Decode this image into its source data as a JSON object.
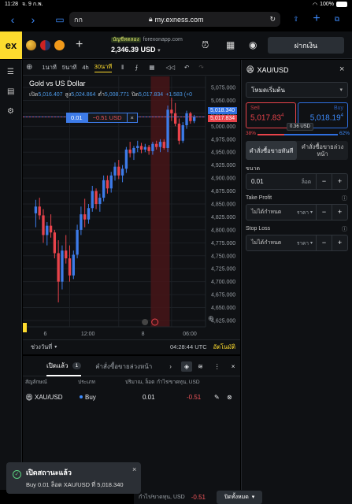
{
  "status": {
    "time": "11:28",
    "date": "จ. 9 ก.พ.",
    "battery": "100%"
  },
  "browser": {
    "tab_label": "กก",
    "url": "my.exness.com"
  },
  "header": {
    "account_tag": "บัญชีทดลอง",
    "server": "forexonapp.com",
    "balance": "2,346.39 USD",
    "deposit_label": "ฝากเงิน"
  },
  "toolbar": {
    "tf1": "1นาที",
    "tf5": "5นาที",
    "tf4h": "4h",
    "tf30": "30นาที"
  },
  "chart": {
    "title": "Gold vs US Dollar",
    "ohlc_open_label": "เปิด",
    "open": "5,016.407",
    "ohlc_high_label": "สูง",
    "high": "5,024.864",
    "ohlc_low_label": "ต่ำ",
    "low": "5,008.771",
    "ohlc_close_label": "ปิด",
    "close": "5,017.834",
    "change": "+1.583 (+0",
    "position_volume": "0.01",
    "position_pl": "−0.51 USD",
    "price_ask": "5,018.340",
    "price_bid": "5,017.834",
    "y_ticks": [
      "5,075.000",
      "5,050.000",
      "5,025.000",
      "5,000.000",
      "4,975.000",
      "4,950.000",
      "4,925.000",
      "4,900.000",
      "4,875.000",
      "4,850.000",
      "4,825.000",
      "4,800.000",
      "4,775.000",
      "4,750.000",
      "4,725.000",
      "4,700.000",
      "4,675.000",
      "4,650.000",
      "4,625.000"
    ],
    "x_ticks": [
      "6",
      "12:00",
      "8",
      "06:00"
    ],
    "range_label": "ช่วงวันที่",
    "clock": "04:28:44 UTC",
    "auto_label": "อัตโนมัติ"
  },
  "chart_data": {
    "type": "candlestick",
    "title": "Gold vs US Dollar",
    "ylim": [
      4625,
      5075
    ],
    "x_labels": [
      "6",
      "12:00",
      "8",
      "06:00"
    ],
    "candles": [
      [
        4832,
        4858,
        4805,
        4845
      ],
      [
        4845,
        4862,
        4820,
        4828
      ],
      [
        4828,
        4840,
        4775,
        4790
      ],
      [
        4790,
        4815,
        4770,
        4808
      ],
      [
        4808,
        4830,
        4785,
        4795
      ],
      [
        4795,
        4800,
        4745,
        4755
      ],
      [
        4755,
        4780,
        4660,
        4700
      ],
      [
        4700,
        4770,
        4685,
        4760
      ],
      [
        4760,
        4790,
        4735,
        4745
      ],
      [
        4745,
        4770,
        4700,
        4712
      ],
      [
        4712,
        4760,
        4705,
        4752
      ],
      [
        4752,
        4810,
        4745,
        4800
      ],
      [
        4800,
        4845,
        4790,
        4830
      ],
      [
        4830,
        4860,
        4805,
        4820
      ],
      [
        4820,
        4850,
        4812,
        4842
      ],
      [
        4842,
        4885,
        4835,
        4875
      ],
      [
        4875,
        4880,
        4840,
        4850
      ],
      [
        4850,
        4870,
        4835,
        4862
      ],
      [
        4862,
        4905,
        4855,
        4896
      ],
      [
        4896,
        4905,
        4870,
        4880
      ],
      [
        4880,
        4912,
        4872,
        4905
      ],
      [
        4905,
        4930,
        4895,
        4922
      ],
      [
        4922,
        4935,
        4898,
        4905
      ],
      [
        4905,
        4925,
        4892,
        4918
      ],
      [
        4918,
        4960,
        4910,
        4955
      ],
      [
        4955,
        4970,
        4940,
        4948
      ],
      [
        4948,
        4962,
        4935,
        4958
      ],
      [
        4958,
        4972,
        4950,
        4962
      ],
      [
        4962,
        4968,
        4948,
        4955
      ],
      [
        4955,
        4966,
        4950,
        4960
      ],
      [
        4960,
        4964,
        4945,
        4952
      ],
      [
        4952,
        4970,
        4945,
        4966
      ],
      [
        4966,
        4972,
        4955,
        4960
      ],
      [
        4960,
        4975,
        4950,
        4970
      ],
      [
        4970,
        4975,
        4955,
        4958
      ],
      [
        4958,
        5040,
        4950,
        5032
      ],
      [
        5032,
        5055,
        5010,
        5025
      ],
      [
        5025,
        5045,
        5000,
        5005
      ],
      [
        5005,
        5015,
        4965,
        4972
      ],
      [
        4972,
        5008,
        4968,
        5002
      ],
      [
        5002,
        5030,
        4995,
        5025
      ],
      [
        5025,
        5028,
        5005,
        5010
      ],
      [
        5010,
        5022,
        5006,
        5018
      ]
    ]
  },
  "right": {
    "symbol": "XAU/USD",
    "mode": "โหมดเริ่มต้น",
    "sell_label": "Sell",
    "sell_price": "5,017.83",
    "sell_sup": "4",
    "buy_label": "Buy",
    "buy_price": "5,018.19",
    "buy_sup": "4",
    "spread": "0.36 USD",
    "sell_pct": "38%",
    "buy_pct": "62%",
    "tab_market": "คำสั่งซื้อขายทันที",
    "tab_pending": "คำสั่งซื้อขายล่วงหน้า",
    "volume_label": "ขนาด",
    "volume_value": "0.01",
    "volume_unit": "ล็อต",
    "tp_label": "Take Profit",
    "tp_value": "ไม่ได้กำหนด",
    "tp_unit": "ราคา",
    "sl_label": "Stop Loss",
    "sl_value": "ไม่ได้กำหนด",
    "sl_unit": "ราคา"
  },
  "orders": {
    "tab_open": "เปิดแล้ว",
    "tab_open_count": "1",
    "tab_pending": "คำสั่งซื้อขายล่วงหน้า",
    "col_symbol": "สัญลักษณ์",
    "col_type": "ประเภท",
    "col_volume": "ปริมาณ, ล็อต",
    "col_pl": "กำไร/ขาดทุน, USD",
    "row": {
      "symbol": "XAU/USD",
      "type": "Buy",
      "volume": "0.01",
      "pl": "-0.51"
    }
  },
  "footer": {
    "label": "กำไร/ขาดทุน, USD",
    "value": "-0.51",
    "close_all": "ปิดทั้งหมด"
  },
  "toast": {
    "title": "เปิดสถานะแล้ว",
    "message": "Buy 0.01 ล็อต XAU/USD ที่ 5,018.340"
  }
}
